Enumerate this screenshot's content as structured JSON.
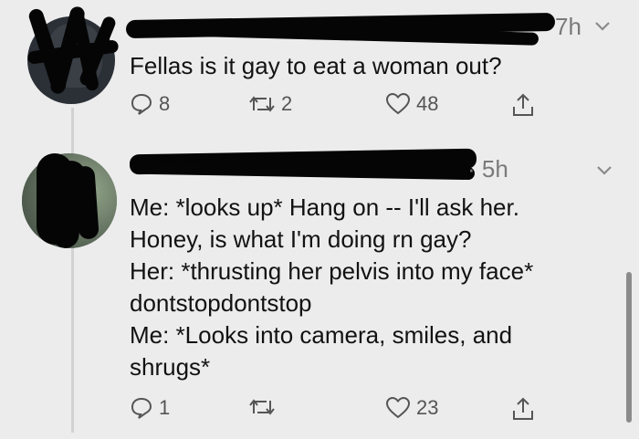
{
  "tweets": [
    {
      "time": "7h",
      "text": "Fellas is it gay to eat a woman out?",
      "reply_count": "8",
      "retweet_count": "2",
      "like_count": "48"
    },
    {
      "time": "· 5h",
      "text": "Me: *looks up* Hang on -- I'll ask her.\nHoney, is what I'm doing rn gay?\nHer: *thrusting her pelvis into my face*\ndontstopdontstop\nMe: *Looks into camera, smiles, and\nshrugs*",
      "reply_count": "1",
      "retweet_count": "",
      "like_count": "23"
    }
  ],
  "colors": {
    "background": "#ececec",
    "text": "#121212",
    "muted": "#7a7a7a",
    "icon": "#555555",
    "redaction": "#050505"
  },
  "icons": [
    "reply-icon",
    "retweet-icon",
    "like-icon",
    "share-icon",
    "chevron-down-icon"
  ]
}
